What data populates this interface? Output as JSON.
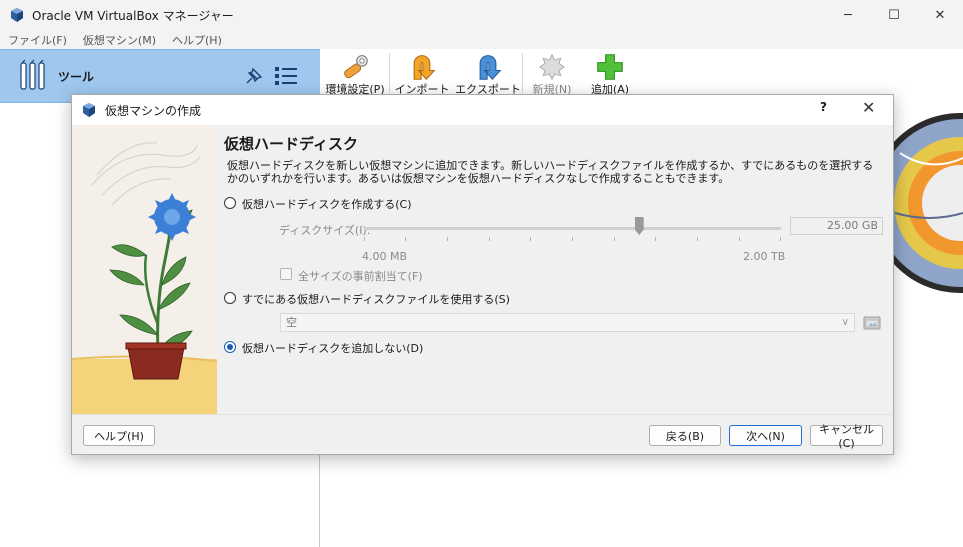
{
  "window": {
    "title": "Oracle VM VirtualBox マネージャー",
    "minimize": "─",
    "maximize": "☐",
    "close": "✕"
  },
  "menu": [
    {
      "label": "ファイル(F)"
    },
    {
      "label": "仮想マシン(M)"
    },
    {
      "label": "ヘルプ(H)"
    }
  ],
  "sidebar": {
    "tools_label": "ツール"
  },
  "toolbar": {
    "preferences_label": "環境設定(P)",
    "import_label": "インポート",
    "export_label": "エクスポート",
    "new_label": "新規(N)",
    "add_label": "追加(A)"
  },
  "dialog": {
    "title": "仮想マシンの作成",
    "help_glyph": "?",
    "close_glyph": "✕",
    "page_title": "仮想ハードディスク",
    "description": "仮想ハードディスクを新しい仮想マシンに追加できます。新しいハードディスクファイルを作成するか、すでにあるものを選択する\nかのいずれかを行います。あるいは仮想マシンを仮想ハードディスクなしで作成することもできます。",
    "options": {
      "create_new": "仮想ハードディスクを作成する(C)",
      "use_existing": "すでにある仮想ハードディスクファイルを使用する(S)",
      "do_not_add": "仮想ハードディスクを追加しない(D)"
    },
    "selected_option": "do_not_add",
    "disk_size_label": "ディスクサイズ(I):",
    "disk_size_value": "25.00 GB",
    "slider_min": "4.00 MB",
    "slider_max": "2.00 TB",
    "slider_fraction": 0.66,
    "preallocate_label": "全サイズの事前割当て(F)",
    "existing_file_value": "空",
    "buttons": {
      "help": "ヘルプ(H)",
      "back": "戻る(B)",
      "next": "次へ(N)",
      "cancel": "キャンセル(C)"
    }
  },
  "colors": {
    "selection": "#9fc8ef",
    "accent": "#1f6fce",
    "primary_border": "#1f6fce"
  }
}
